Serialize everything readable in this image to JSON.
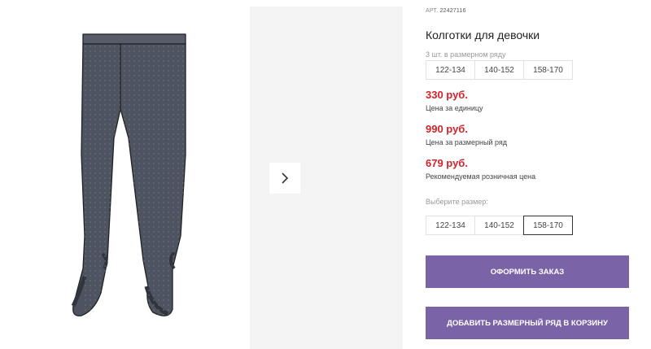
{
  "product": {
    "article_label": "АРТ.",
    "article_number": "22427116",
    "title": "Колготки для девочки",
    "pack_label": "3 шт. в размерном ряду"
  },
  "size_row": [
    "122-134",
    "140-152",
    "158-170"
  ],
  "prices": [
    {
      "value": "330 руб.",
      "caption": "Цена за единицу"
    },
    {
      "value": "990 руб.",
      "caption": "Цена за размерный ряд"
    },
    {
      "value": "679 руб.",
      "caption": "Рекомендуемая розничная цена"
    }
  ],
  "size_select": {
    "label": "Выберите размер:",
    "options": [
      "122-134",
      "140-152",
      "158-170"
    ],
    "selected": "158-170"
  },
  "buttons": {
    "order": "Оформить заказ",
    "add_to_cart": "Добавить размерный ряд в корзину"
  },
  "colors": {
    "price": "#d2232a",
    "button": "#7a63a6",
    "tights": "#4d5360"
  },
  "icons": {
    "next": "chevron-right-icon"
  }
}
